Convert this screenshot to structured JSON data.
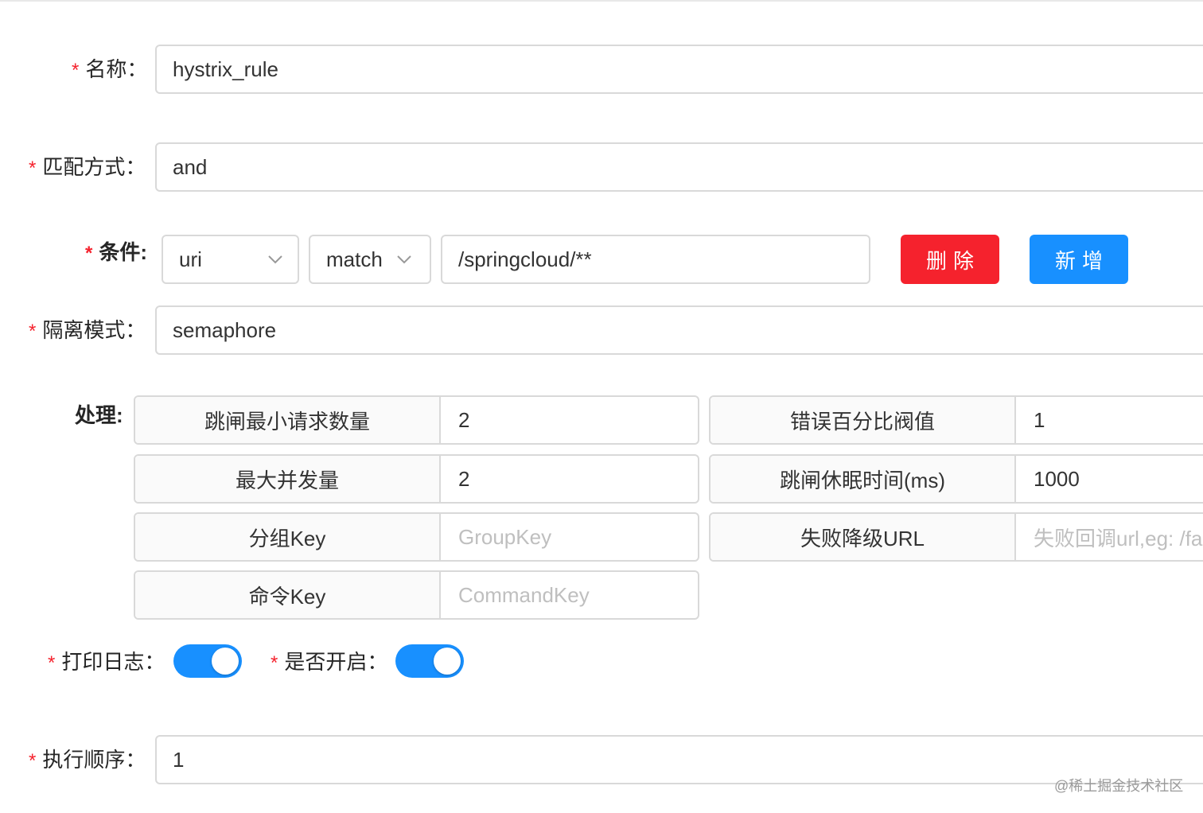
{
  "form": {
    "name": {
      "label": "名称：",
      "value": "hystrix_rule"
    },
    "match_mode": {
      "label": "匹配方式：",
      "value": "and"
    },
    "condition": {
      "label": "条件:",
      "param_type": "uri",
      "operator": "match",
      "value": "/springcloud/**",
      "delete_label": "删除",
      "add_label": "新增"
    },
    "isolation": {
      "label": "隔离模式：",
      "value": "semaphore"
    },
    "handle": {
      "label": "处理:",
      "left": [
        {
          "label": "跳闸最小请求数量",
          "value": "2",
          "placeholder": ""
        },
        {
          "label": "最大并发量",
          "value": "2",
          "placeholder": ""
        },
        {
          "label": "分组Key",
          "value": "",
          "placeholder": "GroupKey"
        },
        {
          "label": "命令Key",
          "value": "",
          "placeholder": "CommandKey"
        }
      ],
      "right": [
        {
          "label": "错误百分比阀值",
          "value": "1",
          "placeholder": ""
        },
        {
          "label": "跳闸休眠时间(ms)",
          "value": "1000",
          "placeholder": ""
        },
        {
          "label": "失败降级URL",
          "value": "",
          "placeholder": "失败回调url,eg: /fa"
        }
      ]
    },
    "log": {
      "label": "打印日志：",
      "enabled": true
    },
    "enabled": {
      "label": "是否开启：",
      "enabled": true
    },
    "sort": {
      "label": "执行顺序：",
      "value": "1"
    }
  },
  "watermark": "@稀土掘金技术社区",
  "colors": {
    "primary": "#1890ff",
    "danger": "#f5222d",
    "required": "#f5222d",
    "placeholder": "#bfbfbf"
  }
}
